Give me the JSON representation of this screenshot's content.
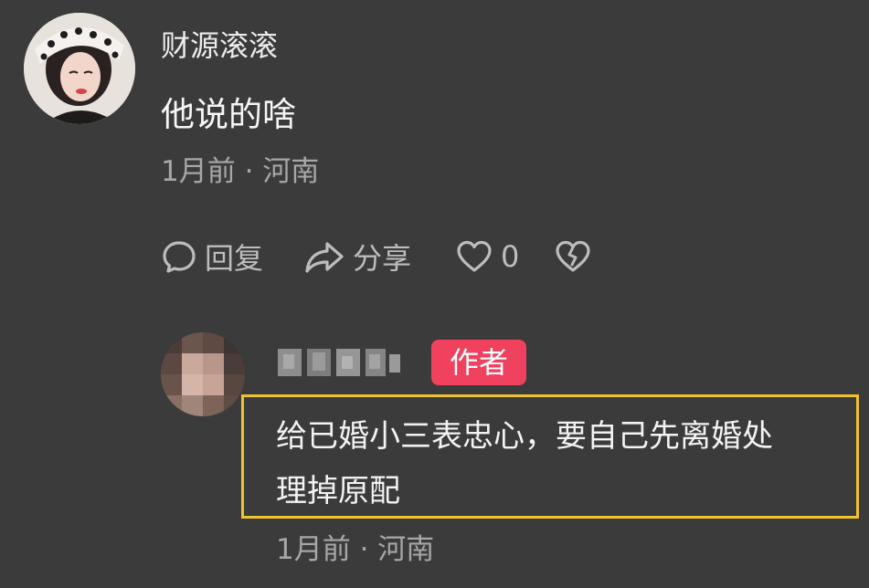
{
  "comment": {
    "username": "财源滚滚",
    "text": "他说的啥",
    "meta": "1月前 · 河南",
    "actions": {
      "reply_label": "回复",
      "share_label": "分享",
      "like_count": "0"
    }
  },
  "reply": {
    "badge": "作者",
    "text_line1": "给已婚小三表忠心，要自己先离婚处",
    "text_line2": "理掉原配",
    "meta": "1月前 · 河南",
    "highlight_color": "#f0c22c"
  },
  "colors": {
    "background": "#3b3b3b",
    "badge": "#f0425e",
    "meta_text": "#a7a7a7"
  },
  "icons": [
    "comment-bubble-icon",
    "share-arrow-icon",
    "heart-icon",
    "broken-heart-icon"
  ]
}
